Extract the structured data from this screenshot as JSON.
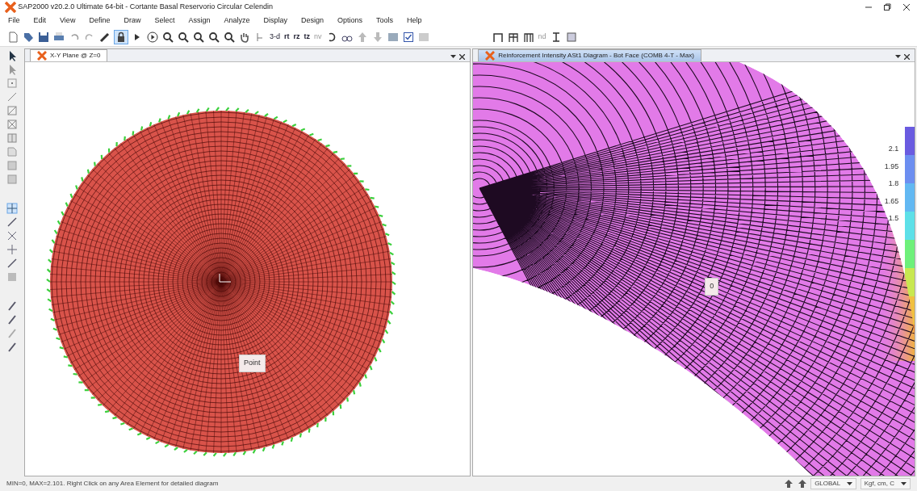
{
  "window": {
    "title": "SAP2000 v20.2.0 Ultimate 64-bit - Cortante Basal Reservorio Circular Celendin"
  },
  "menu": [
    "File",
    "Edit",
    "View",
    "Define",
    "Draw",
    "Select",
    "Assign",
    "Analyze",
    "Display",
    "Design",
    "Options",
    "Tools",
    "Help"
  ],
  "toolbar": {
    "text_buttons": [
      "3-d",
      "rt",
      "rz",
      "tz",
      "nv"
    ],
    "nd_button": "nd"
  },
  "panels": [
    {
      "tab": "X-Y Plane @ Z=0",
      "active": false,
      "tooltip": "Point"
    },
    {
      "tab": "Reinforcement Intensity ASt1 Diagram - Bot Face  (COMB 4-T - Max)",
      "active": true,
      "tooltip": "0"
    }
  ],
  "legend": [
    "2.1",
    "1.95",
    "1.8",
    "1.65",
    "1.5"
  ],
  "status_bar": {
    "message": "MIN=0, MAX=2.101. Right Click on any Area Element for detailed diagram",
    "coord_system": "GLOBAL",
    "units": "Kgf, cm, C"
  }
}
